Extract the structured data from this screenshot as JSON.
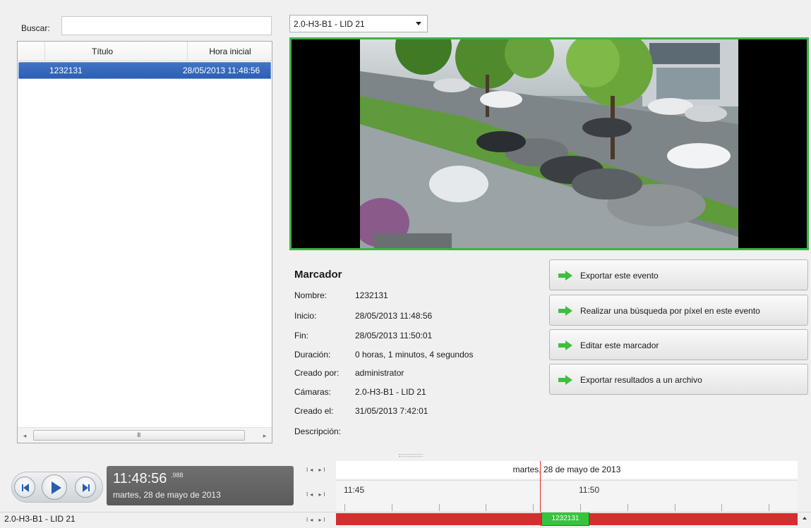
{
  "search": {
    "label": "Buscar:",
    "value": ""
  },
  "list": {
    "columns": [
      "Título",
      "Hora inicial"
    ],
    "rows": [
      {
        "title": "1232131",
        "start": "28/05/2013 11:48:56"
      }
    ],
    "scroll_grip": "III"
  },
  "camera_select": {
    "selected": "2.0-H3-B1 - LID 21"
  },
  "bookmark": {
    "heading": "Marcador",
    "fields": [
      {
        "label": "Nombre:",
        "value": "1232131"
      },
      {
        "label": "Inicio:",
        "value": "28/05/2013 11:48:56"
      },
      {
        "label": "Fin:",
        "value": "28/05/2013 11:50:01"
      },
      {
        "label": "Duración:",
        "value": "0 horas, 1 minutos, 4 segundos"
      },
      {
        "label": "Creado por:",
        "value": "administrator"
      },
      {
        "label": "Cámaras:",
        "value": "2.0-H3-B1 - LID 21"
      },
      {
        "label": "Creado el:",
        "value": "31/05/2013 7:42:01"
      },
      {
        "label": "Descripción:",
        "value": ""
      }
    ]
  },
  "actions": [
    "Exportar este evento",
    "Realizar una búsqueda por píxel en este evento",
    "Editar este marcador",
    "Exportar resultados a un archivo"
  ],
  "playback": {
    "time": "11:48:56",
    "ms": ".988",
    "date": "martes, 28 de mayo de 2013"
  },
  "timeline": {
    "date": "martes, 28 de mayo de 2013",
    "tick_labels": [
      "11:45",
      "11:50"
    ],
    "marker_label": "1232131"
  },
  "status": {
    "camera": "2.0-H3-B1 - LID 21"
  },
  "colors": {
    "accent_green": "#3fb14b",
    "selection_blue": "#2d5fb4",
    "timeline_red": "#d32f2f"
  }
}
